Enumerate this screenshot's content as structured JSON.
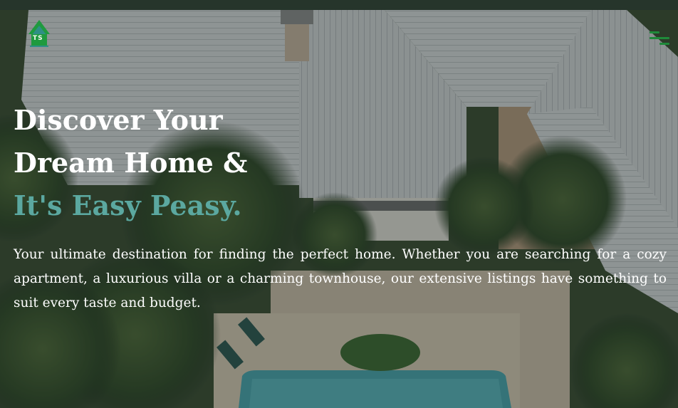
{
  "logo": {
    "text": "TS",
    "icon": "house-logo-icon",
    "colors": {
      "green": "#1f9a3f",
      "teal": "#2f8f86"
    }
  },
  "menu": {
    "icon": "hamburger-menu-icon",
    "color": "#1f8a3a"
  },
  "hero": {
    "headline_line1": "Discover Your",
    "headline_line2": "Dream Home &",
    "headline_accent": "It's Easy Peasy.",
    "accent_color": "#5ba8a0",
    "description": "Your ultimate destination for finding the perfect home. Whether you are searching for a cozy apartment, a luxurious villa or a charming townhouse, our extensive listings have something to suit every taste and budget."
  }
}
